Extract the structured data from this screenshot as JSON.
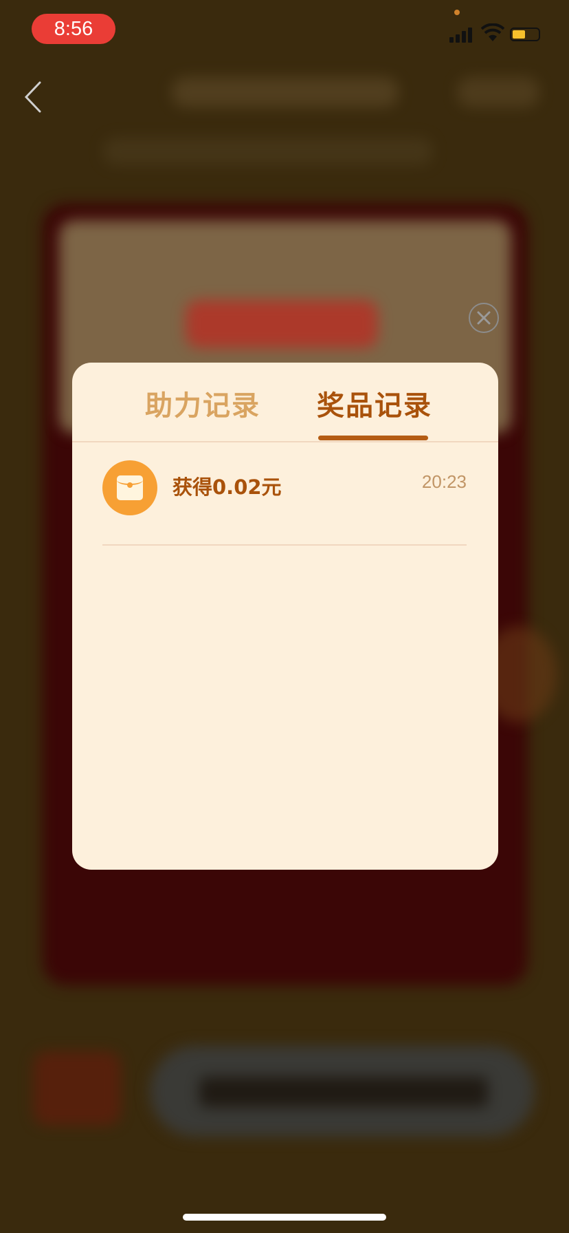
{
  "status_bar": {
    "time": "8:56"
  },
  "modal": {
    "tabs": [
      {
        "label": "助力记录",
        "active": false
      },
      {
        "label": "奖品记录",
        "active": true
      }
    ],
    "records": [
      {
        "icon": "red-envelope-icon",
        "text": "获得0.02元",
        "time": "20:23"
      }
    ]
  },
  "colors": {
    "accent": "#a9520b",
    "inactive_tab": "#d9a461",
    "modal_bg": "#fdf0dc",
    "icon_bg": "#f7a034",
    "time_pill": "#ea3d36"
  }
}
